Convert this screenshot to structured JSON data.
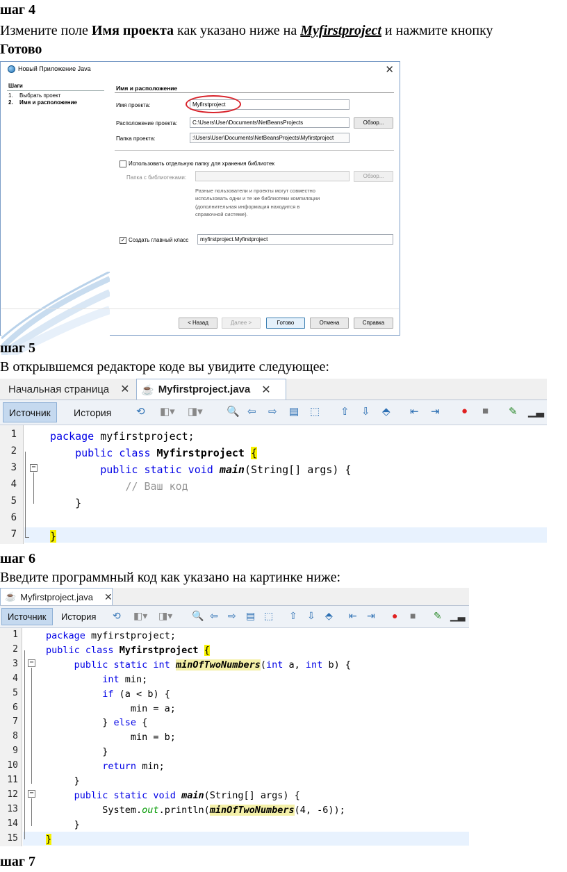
{
  "step4": {
    "title": "шаг 4",
    "text_pre": "Измените поле ",
    "text_bold": "Имя проекта",
    "text_mid": " как указано ниже на ",
    "text_link": "Myfirstproject",
    "text_post": " и нажмите кнопку",
    "text_bold2": "Готово"
  },
  "dialog": {
    "title": "Новый Приложение Java",
    "steps_header": "Шаги",
    "steps": [
      {
        "num": "1.",
        "label": "Выбрать проект"
      },
      {
        "num": "2.",
        "label": "Имя и расположение"
      }
    ],
    "section_title": "Имя и расположение",
    "project_name_label": "Имя проекта:",
    "project_name_value": "Myfirstproject",
    "location_label": "Расположение проекта:",
    "location_value": "C:\\Users\\User\\Documents\\NetBeansProjects",
    "folder_label": "Папка проекта:",
    "folder_value": ":\\Users\\User\\Documents\\NetBeansProjects\\Myfirstproject",
    "browse_label": "Обзор...",
    "separate_folder_label": "Использовать отдельную папку для хранения библиотек",
    "libs_folder_label": "Папка с библиотеками:",
    "libs_folder_value": "",
    "hint_lines": [
      "Разные пользователи и проекты могут совместно",
      "использовать одни и те же библиотеки компиляции",
      "(дополнительная информация находится в",
      "справочной системе)."
    ],
    "main_class_label": "Создать главный класс",
    "main_class_value": "myfirstproject.Myfirstproject",
    "buttons": {
      "back": "< Назад",
      "next": "Далее >",
      "finish": "Готово",
      "cancel": "Отмена",
      "help": "Справка"
    }
  },
  "step5": {
    "title": "шаг 5",
    "text": "В открывшемся редакторе коде вы увидите следующее:"
  },
  "editor1": {
    "tabs": [
      "Начальная страница",
      "Myfirstproject.java"
    ],
    "toolbar": {
      "source": "Источник",
      "history": "История"
    },
    "line_numbers": [
      "1",
      "2",
      "3",
      "4",
      "5",
      "6",
      "7"
    ]
  },
  "step6": {
    "title": "шаг 6",
    "text": "Введите программный код как указано на картинке ниже:"
  },
  "editor2": {
    "tabs": [
      "Myfirstproject.java"
    ],
    "toolbar": {
      "source": "Источник",
      "history": "История"
    },
    "line_numbers": [
      "1",
      "2",
      "3",
      "4",
      "5",
      "6",
      "7",
      "8",
      "9",
      "10",
      "11",
      "12",
      "13",
      "14",
      "15"
    ]
  },
  "step7": {
    "title": "шаг 7"
  },
  "colors": {
    "keyword": "#0000e6",
    "comment": "#969696",
    "highlight": "#f7f200",
    "static_field": "#009900",
    "annotation_circle": "#d8222a"
  }
}
